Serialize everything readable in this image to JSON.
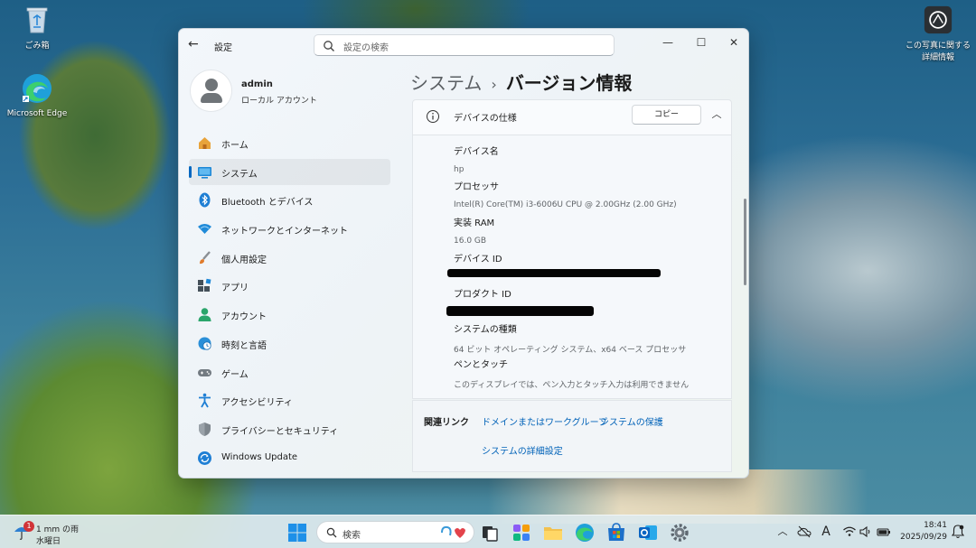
{
  "desktop": {
    "icons": [
      {
        "label": "ごみ箱",
        "icon": "recycle-bin-icon"
      },
      {
        "label": "Microsoft Edge",
        "icon": "edge-icon"
      },
      {
        "label": "この写真に関する詳細情報",
        "icon": "camera-info-icon"
      }
    ]
  },
  "window": {
    "app_title": "設定",
    "search_placeholder": "設定の検索",
    "controls": {
      "minimize": "—",
      "maximize": "☐",
      "close": "✕"
    }
  },
  "profile": {
    "name": "admin",
    "account_type": "ローカル アカウント"
  },
  "sidebar": {
    "items": [
      {
        "label": "ホーム",
        "icon": "home-icon"
      },
      {
        "label": "システム",
        "icon": "system-monitor-icon",
        "active": true
      },
      {
        "label": "Bluetooth とデバイス",
        "icon": "bluetooth-icon"
      },
      {
        "label": "ネットワークとインターネット",
        "icon": "wifi-icon"
      },
      {
        "label": "個人用設定",
        "icon": "paintbrush-icon"
      },
      {
        "label": "アプリ",
        "icon": "apps-icon"
      },
      {
        "label": "アカウント",
        "icon": "account-icon"
      },
      {
        "label": "時刻と言語",
        "icon": "globe-clock-icon"
      },
      {
        "label": "ゲーム",
        "icon": "gamepad-icon"
      },
      {
        "label": "アクセシビリティ",
        "icon": "accessibility-icon"
      },
      {
        "label": "プライバシーとセキュリティ",
        "icon": "shield-icon"
      },
      {
        "label": "Windows Update",
        "icon": "update-icon"
      }
    ]
  },
  "breadcrumb": {
    "parent": "システム",
    "separator": "›",
    "current": "バージョン情報"
  },
  "device_specs": {
    "title": "デバイスの仕様",
    "copy_label": "コピー",
    "collapse_icon": "chevron-up-icon",
    "rows": [
      {
        "key": "デバイス名",
        "value": "hp"
      },
      {
        "key": "プロセッサ",
        "value": "Intel(R) Core(TM) i3-6006U CPU @ 2.00GHz (2.00 GHz)"
      },
      {
        "key": "実装 RAM",
        "value": "16.0 GB"
      },
      {
        "key": "デバイス ID",
        "value": "",
        "redacted": true
      },
      {
        "key": "プロダクト ID",
        "value": "",
        "redacted": true
      },
      {
        "key": "システムの種類",
        "value": "64 ビット オペレーティング システム、x64 ベース プロセッサ"
      },
      {
        "key": "ペンとタッチ",
        "value": "このディスプレイでは、ペン入力とタッチ入力は利用できません"
      }
    ]
  },
  "related_links": {
    "title": "関連リンク",
    "links": [
      "ドメインまたはワークグループ",
      "システムの保護",
      "システムの詳細設定"
    ]
  },
  "taskbar": {
    "weather": {
      "line1": "1 mm の雨",
      "line2": "水曜日",
      "badge": "1"
    },
    "search_placeholder": "検索",
    "clock": {
      "time": "18:41",
      "date": "2025/09/29"
    },
    "tray_ime": "A",
    "colors": {
      "accent": "#0067c0"
    }
  }
}
